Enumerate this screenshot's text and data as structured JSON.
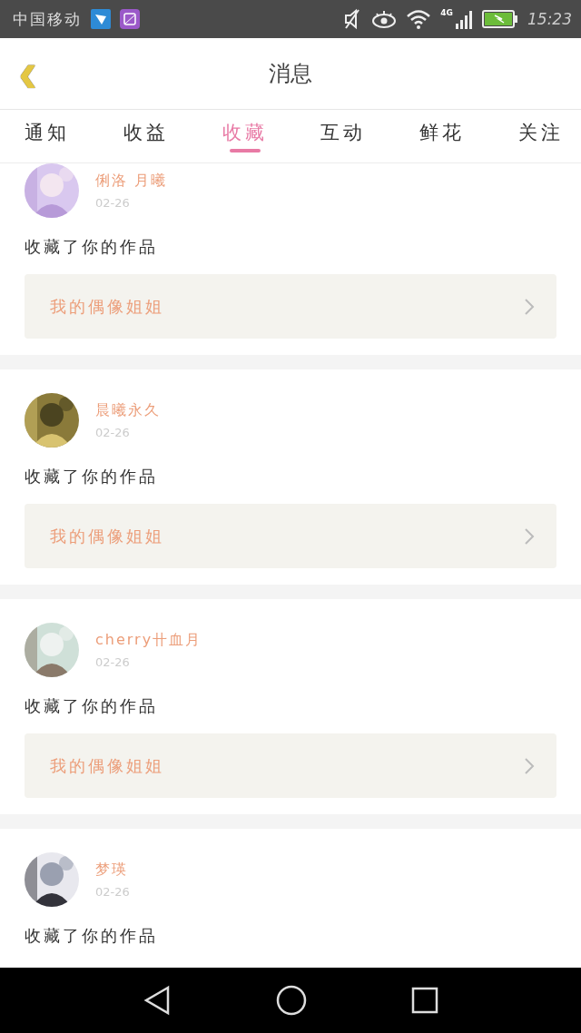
{
  "status_bar": {
    "carrier": "中国移动",
    "network": "4G",
    "time": "15:23"
  },
  "header": {
    "back": "‹",
    "title": "消息"
  },
  "tabs": [
    {
      "label": "通知",
      "selected": false
    },
    {
      "label": "收益",
      "selected": false
    },
    {
      "label": "收藏",
      "selected": true
    },
    {
      "label": "互动",
      "selected": false
    },
    {
      "label": "鲜花",
      "selected": false
    },
    {
      "label": "关注",
      "selected": false
    }
  ],
  "messages": [
    {
      "name": "俐洛 月曦",
      "date": "02-26",
      "text": "收藏了你的作品",
      "work": "我的偶像姐姐"
    },
    {
      "name": "晨曦永久",
      "date": "02-26",
      "text": "收藏了你的作品",
      "work": "我的偶像姐姐"
    },
    {
      "name": "cherry卄血月",
      "date": "02-26",
      "text": "收藏了你的作品",
      "work": "我的偶像姐姐"
    },
    {
      "name": "梦瑛",
      "date": "02-26",
      "text": "收藏了你的作品"
    }
  ]
}
